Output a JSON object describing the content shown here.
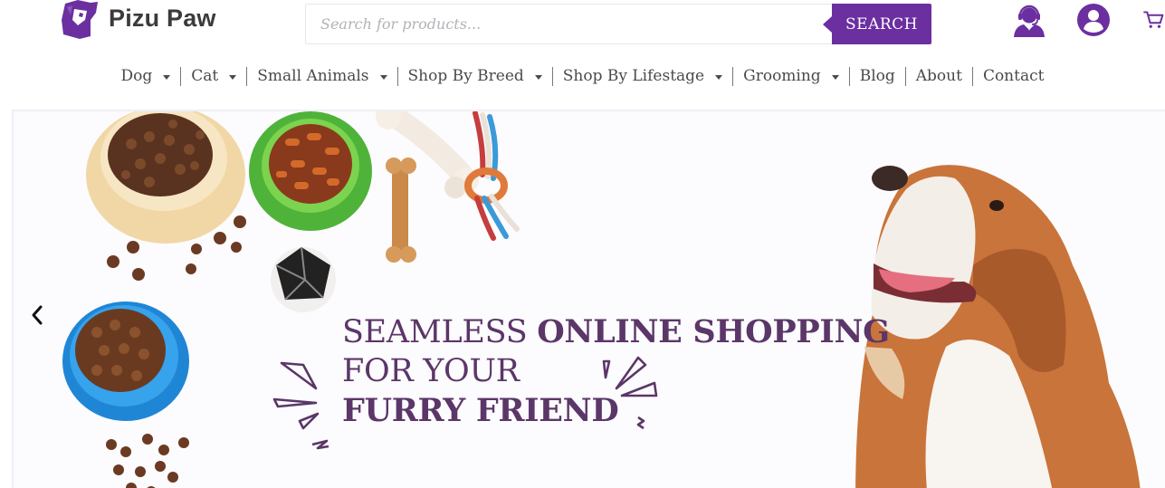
{
  "brand": {
    "name": "Pizu Paw"
  },
  "search": {
    "placeholder": "Search for products...",
    "button_label": "SEARCH"
  },
  "header_icons": [
    "headset-support-icon",
    "account-icon",
    "cart-icon"
  ],
  "nav": {
    "items": [
      {
        "label": "Dog",
        "dropdown": true
      },
      {
        "label": "Cat",
        "dropdown": true
      },
      {
        "label": "Small Animals",
        "dropdown": true
      },
      {
        "label": "Shop By Breed",
        "dropdown": true
      },
      {
        "label": "Shop By Lifestage",
        "dropdown": true
      },
      {
        "label": "Grooming",
        "dropdown": true
      },
      {
        "label": "Blog",
        "dropdown": false
      },
      {
        "label": "About",
        "dropdown": false
      },
      {
        "label": "Contact",
        "dropdown": false
      }
    ]
  },
  "hero": {
    "line1_light": "SEAMLESS ",
    "line1_bold": "ONLINE SHOPPING",
    "line2_light": "FOR YOUR",
    "line3_bold": "FURRY FRIEND"
  },
  "colors": {
    "brand_purple": "#6b2fa0",
    "headline_purple": "#5b3668",
    "text": "#4a4a4a"
  }
}
